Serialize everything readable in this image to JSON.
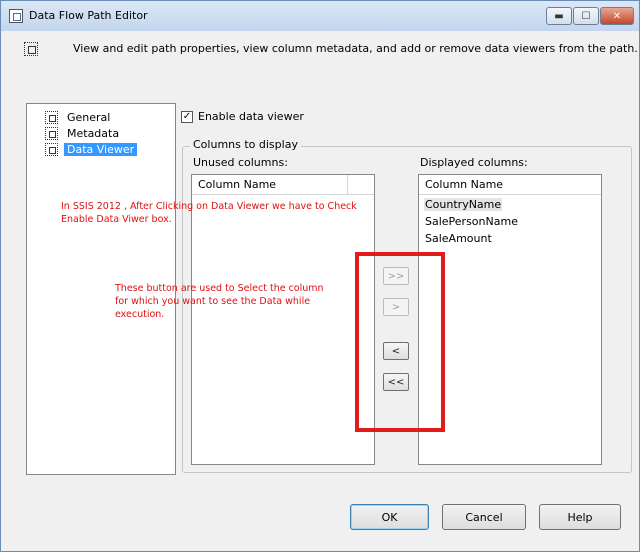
{
  "window": {
    "title": "Data Flow Path Editor",
    "description": "View and edit path properties, view column metadata, and add or remove data viewers from the path."
  },
  "nav": {
    "items": [
      {
        "label": "General",
        "selected": false
      },
      {
        "label": "Metadata",
        "selected": false
      },
      {
        "label": "Data Viewer",
        "selected": true
      }
    ]
  },
  "data_viewer": {
    "enable_label": "Enable data viewer",
    "enabled": true,
    "group_label": "Columns to display",
    "unused_label": "Unused columns:",
    "displayed_label": "Displayed columns:",
    "column_header": "Column Name",
    "unused_columns": [],
    "displayed_columns": [
      "CountryName",
      "SalePersonName",
      "SaleAmount"
    ],
    "buttons": {
      "add_all": ">>",
      "add": ">",
      "remove": "<",
      "remove_all": "<<"
    }
  },
  "annotations": {
    "note1": "In SSIS 2012 , After Clicking on Data Viewer we have to Check Enable Data Viwer box.",
    "note2": "These button are used to Select the column for which you want to see the Data while execution."
  },
  "footer": {
    "ok": "OK",
    "cancel": "Cancel",
    "help": "Help"
  },
  "colors": {
    "annotation": "#e01010",
    "selection": "#3399ff"
  }
}
